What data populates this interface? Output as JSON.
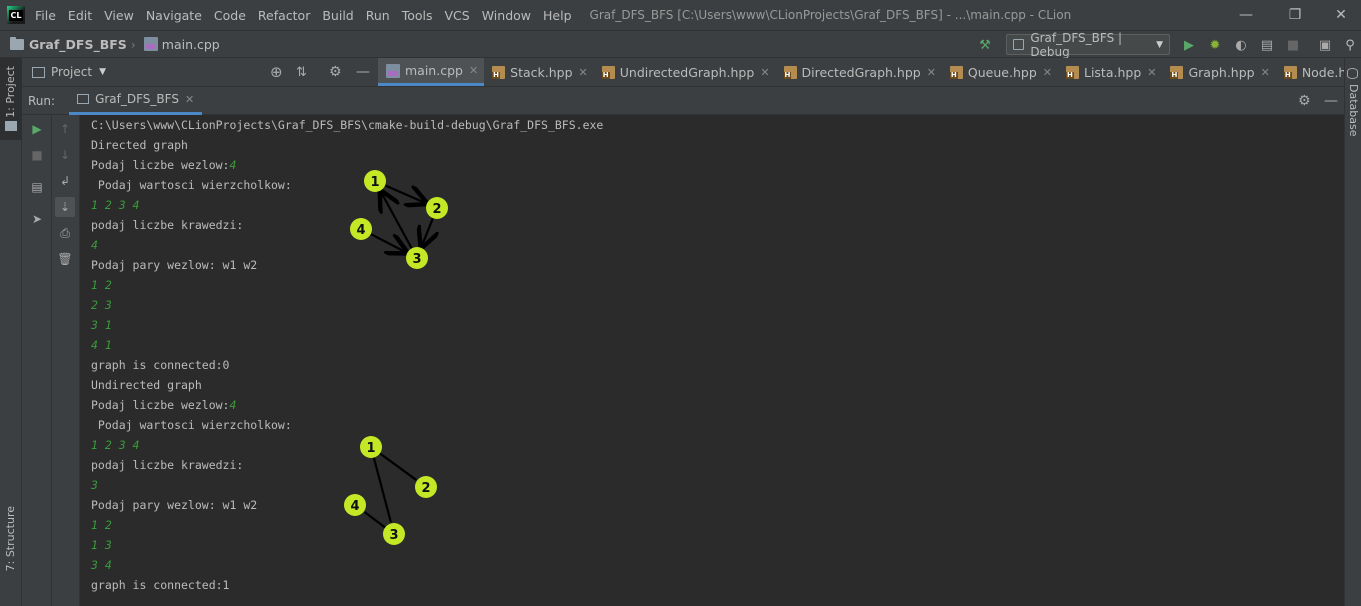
{
  "menubar": {
    "logo": "CL",
    "items": [
      "File",
      "Edit",
      "View",
      "Navigate",
      "Code",
      "Refactor",
      "Build",
      "Run",
      "Tools",
      "VCS",
      "Window",
      "Help"
    ],
    "window_title": "Graf_DFS_BFS [C:\\Users\\www\\CLionProjects\\Graf_DFS_BFS] - ...\\main.cpp - CLion"
  },
  "navbar": {
    "project": "Graf_DFS_BFS",
    "file": "main.cpp",
    "run_config": "Graf_DFS_BFS | Debug"
  },
  "left_strip": {
    "project_label": "1: Project",
    "structure_label": "7: Structure"
  },
  "right_strip": {
    "database_label": "Database"
  },
  "project_panel": {
    "title": "Project"
  },
  "editor_tabs": [
    {
      "label": "main.cpp",
      "active": true,
      "type": "cpp"
    },
    {
      "label": "Stack.hpp",
      "type": "h"
    },
    {
      "label": "UndirectedGraph.hpp",
      "type": "h"
    },
    {
      "label": "DirectedGraph.hpp",
      "type": "h"
    },
    {
      "label": "Queue.hpp",
      "type": "h"
    },
    {
      "label": "Lista.hpp",
      "type": "h"
    },
    {
      "label": "Graph.hpp",
      "type": "h"
    },
    {
      "label": "Node.hpp",
      "type": "h"
    }
  ],
  "tabs_overflow": "⋯≡",
  "run_panel": {
    "label": "Run:",
    "tab": "Graf_DFS_BFS"
  },
  "console": [
    {
      "text": "C:\\Users\\www\\CLionProjects\\Graf_DFS_BFS\\cmake-build-debug\\Graf_DFS_BFS.exe"
    },
    {
      "text": "Directed graph"
    },
    {
      "text": "Podaj liczbe wezlow:",
      "input": "4"
    },
    {
      "text": " Podaj wartosci wierzcholkow:"
    },
    {
      "text": "",
      "input": "1 2 3 4"
    },
    {
      "text": "podaj liczbe krawedzi:"
    },
    {
      "text": "",
      "input": "4"
    },
    {
      "text": "Podaj pary wezlow: w1 w2"
    },
    {
      "text": "",
      "input": "1 2"
    },
    {
      "text": "",
      "input": "2 3"
    },
    {
      "text": "",
      "input": "3 1"
    },
    {
      "text": "",
      "input": "4 1"
    },
    {
      "text": "graph is connected:0"
    },
    {
      "text": "Undirected graph"
    },
    {
      "text": "Podaj liczbe wezlow:",
      "input": "4"
    },
    {
      "text": " Podaj wartosci wierzcholkow:"
    },
    {
      "text": "",
      "input": "1 2 3 4"
    },
    {
      "text": "podaj liczbe krawedzi:"
    },
    {
      "text": "",
      "input": "3"
    },
    {
      "text": "Podaj pary wezlow: w1 w2"
    },
    {
      "text": "",
      "input": "1 2"
    },
    {
      "text": "",
      "input": "1 3"
    },
    {
      "text": "",
      "input": "3 4"
    },
    {
      "text": "graph is connected:1"
    }
  ],
  "graphs": [
    {
      "name": "directed",
      "node_color": "#c5e826",
      "nodes": [
        {
          "label": "1"
        },
        {
          "label": "2"
        },
        {
          "label": "3"
        },
        {
          "label": "4"
        }
      ],
      "edges": [
        [
          "1",
          "2"
        ],
        [
          "2",
          "3"
        ],
        [
          "3",
          "1"
        ],
        [
          "4",
          "3"
        ]
      ]
    },
    {
      "name": "undirected",
      "node_color": "#c5e826",
      "nodes": [
        {
          "label": "1"
        },
        {
          "label": "2"
        },
        {
          "label": "3"
        },
        {
          "label": "4"
        }
      ],
      "edges": [
        [
          "1",
          "2"
        ],
        [
          "1",
          "3"
        ],
        [
          "3",
          "4"
        ]
      ]
    }
  ],
  "colors": {
    "accent": "#4a88c7",
    "input_text": "#3a9a3a",
    "run_green": "#59a869",
    "debug_green": "#88b436"
  }
}
